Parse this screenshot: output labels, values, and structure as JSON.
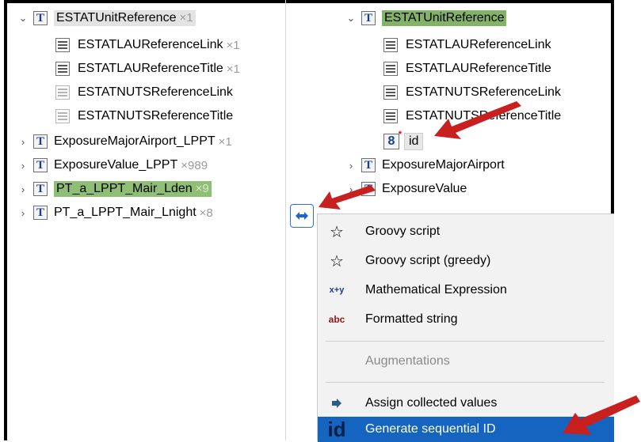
{
  "left_tree": [
    {
      "chevron": "⌄",
      "icon": "T",
      "label": "ESTATUnitReference",
      "mult": "×1",
      "highlight": "grey"
    },
    {
      "icon": "list",
      "label": "ESTATLAUReferenceLink",
      "mult": "×1"
    },
    {
      "icon": "list",
      "label": "ESTATLAUReferenceTitle",
      "mult": "×1"
    },
    {
      "icon": "list-light",
      "label": "ESTATNUTSReferenceLink",
      "mult": ""
    },
    {
      "icon": "list-light",
      "label": "ESTATNUTSReferenceTitle",
      "mult": ""
    },
    {
      "chevron": "›",
      "icon": "T",
      "label": "ExposureMajorAirport_LPPT",
      "mult": "×1"
    },
    {
      "chevron": "›",
      "icon": "T",
      "label": "ExposureValue_LPPT",
      "mult": "×989"
    },
    {
      "chevron": "›",
      "icon": "T",
      "label": "PT_a_LPPT_Mair_Lden",
      "mult": "×9",
      "highlight": "green"
    },
    {
      "chevron": "›",
      "icon": "T",
      "label": "PT_a_LPPT_Mair_Lnight",
      "mult": "×8"
    }
  ],
  "right_tree": [
    {
      "chevron": "⌄",
      "icon": "T",
      "label": "ESTATUnitReference",
      "highlight": "green"
    },
    {
      "icon": "list",
      "label": "ESTATLAUReferenceLink"
    },
    {
      "icon": "list",
      "label": "ESTATLAUReferenceTitle"
    },
    {
      "icon": "list",
      "label": "ESTATNUTSReferenceLink"
    },
    {
      "icon": "list",
      "label": "ESTATNUTSReferenceTitle"
    },
    {
      "icon": "8",
      "label": "id"
    },
    {
      "chevron": "›",
      "icon": "T",
      "label": "ExposureMajorAirport"
    },
    {
      "chevron": "›",
      "icon": "T",
      "label": "ExposureValue"
    }
  ],
  "menu": {
    "items": [
      {
        "icon": "☆",
        "label": "Groovy script"
      },
      {
        "icon": "☆",
        "label": "Groovy script (greedy)"
      },
      {
        "icon": "x+y",
        "label": "Mathematical Expression"
      },
      {
        "icon": "abc",
        "label": "Formatted string"
      },
      {
        "label": "Augmentations",
        "disabled": true
      },
      {
        "icon": "arrow",
        "label": "Assign collected values"
      },
      {
        "icon": "id",
        "label": "Generate sequential ID",
        "selected": true
      }
    ]
  },
  "colors": {
    "selection": "#1565c0",
    "highlight_green": "#82b366",
    "arrow_red": "#c8201f"
  }
}
